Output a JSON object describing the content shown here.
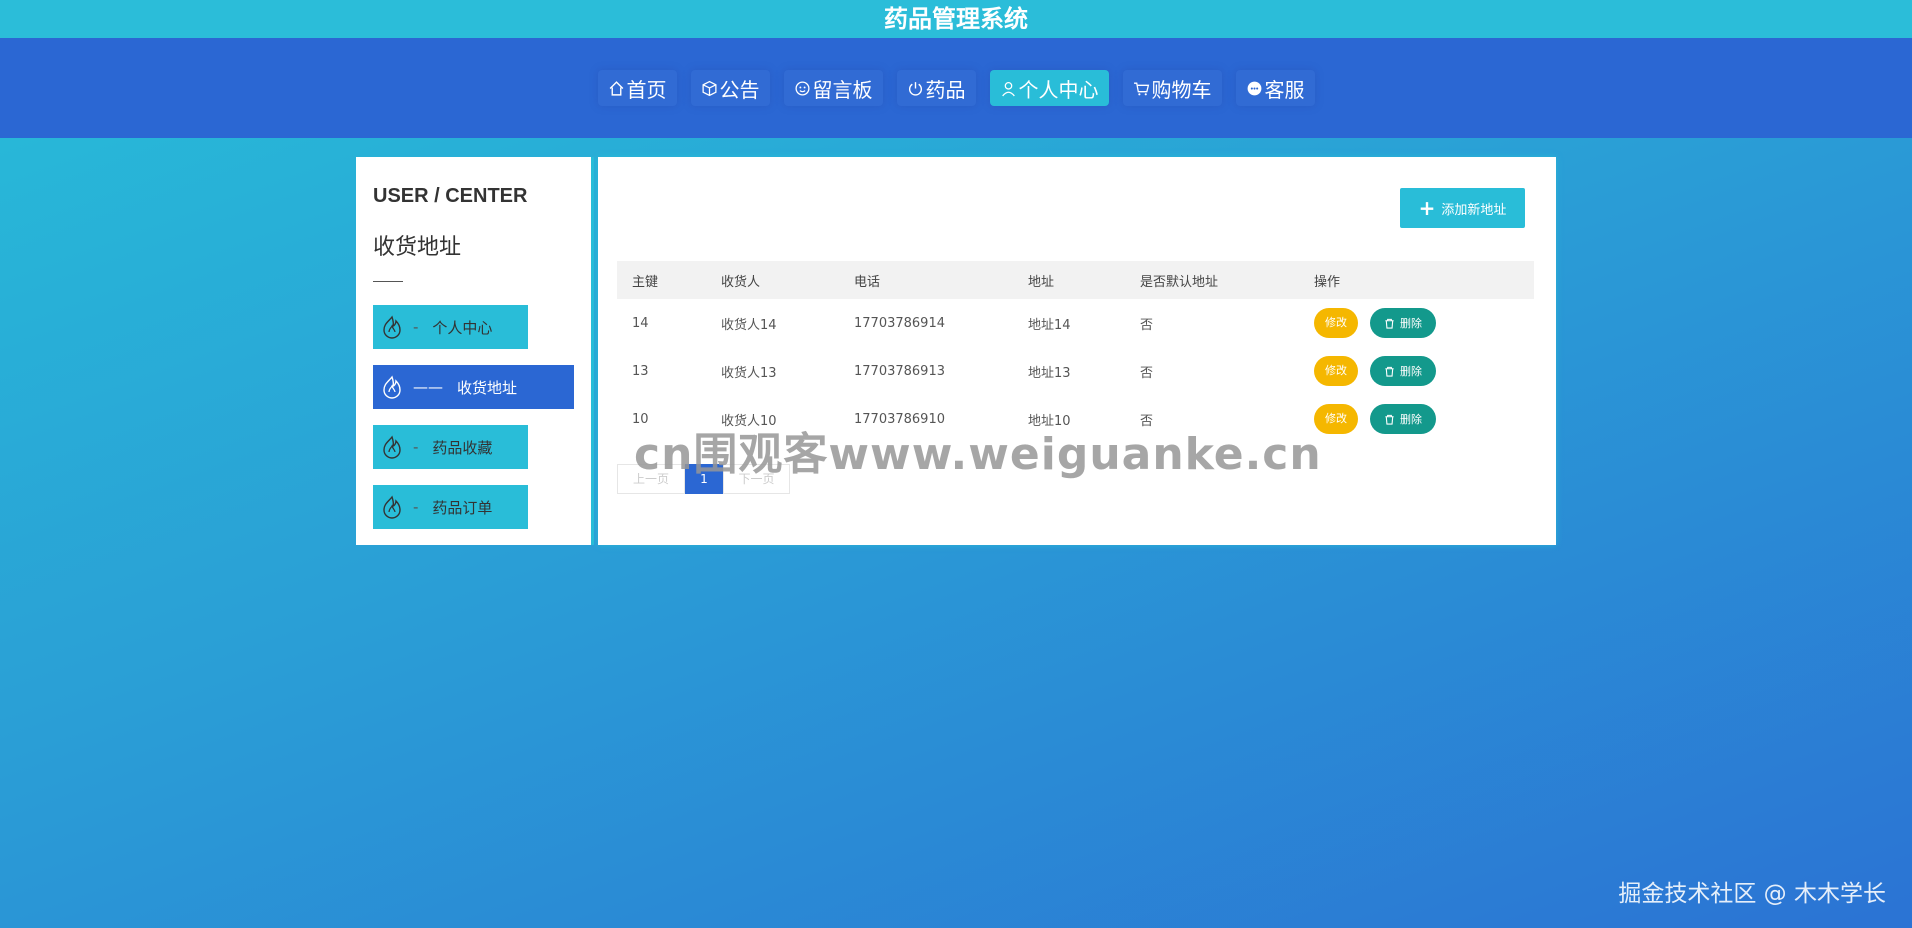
{
  "app": {
    "title": "药品管理系统"
  },
  "nav": {
    "items": [
      {
        "label": "首页",
        "icon": "home-icon"
      },
      {
        "label": "公告",
        "icon": "box-icon"
      },
      {
        "label": "留言板",
        "icon": "smile-icon"
      },
      {
        "label": "药品",
        "icon": "power-icon"
      },
      {
        "label": "个人中心",
        "icon": "user-icon",
        "active": true
      },
      {
        "label": "购物车",
        "icon": "cart-icon"
      },
      {
        "label": "客服",
        "icon": "chat-icon"
      }
    ]
  },
  "sidebar": {
    "heading": "USER / CENTER",
    "subtitle": "收货地址",
    "items": [
      {
        "label": "个人中心",
        "dash": "-",
        "icon": "flame-icon"
      },
      {
        "label": "收货地址",
        "dash": "——",
        "icon": "flame-icon",
        "active": true
      },
      {
        "label": "药品收藏",
        "dash": "-",
        "icon": "flame-icon"
      },
      {
        "label": "药品订单",
        "dash": "-",
        "icon": "flame-icon"
      }
    ]
  },
  "toolbar": {
    "add_label": "添加新地址",
    "add_icon": "plus-icon"
  },
  "table": {
    "columns": [
      "主键",
      "收货人",
      "电话",
      "地址",
      "是否默认地址",
      "操作"
    ],
    "rows": [
      {
        "id": "14",
        "name": "收货人14",
        "phone": "17703786914",
        "address": "地址14",
        "default": "否"
      },
      {
        "id": "13",
        "name": "收货人13",
        "phone": "17703786913",
        "address": "地址13",
        "default": "否"
      },
      {
        "id": "10",
        "name": "收货人10",
        "phone": "17703786910",
        "address": "地址10",
        "default": "否"
      }
    ],
    "edit_label": "修改",
    "delete_label": "删除"
  },
  "pagination": {
    "prev": "上一页",
    "current": "1",
    "next": "下一页"
  },
  "overlay": {
    "watermark": "cn围观客www.weiguanke.cn",
    "credit": "掘金技术社区 @ 木木学长"
  },
  "colors": {
    "accent": "#29bdd8",
    "primary": "#2b67d3",
    "edit": "#f5b700",
    "delete": "#13998c"
  }
}
